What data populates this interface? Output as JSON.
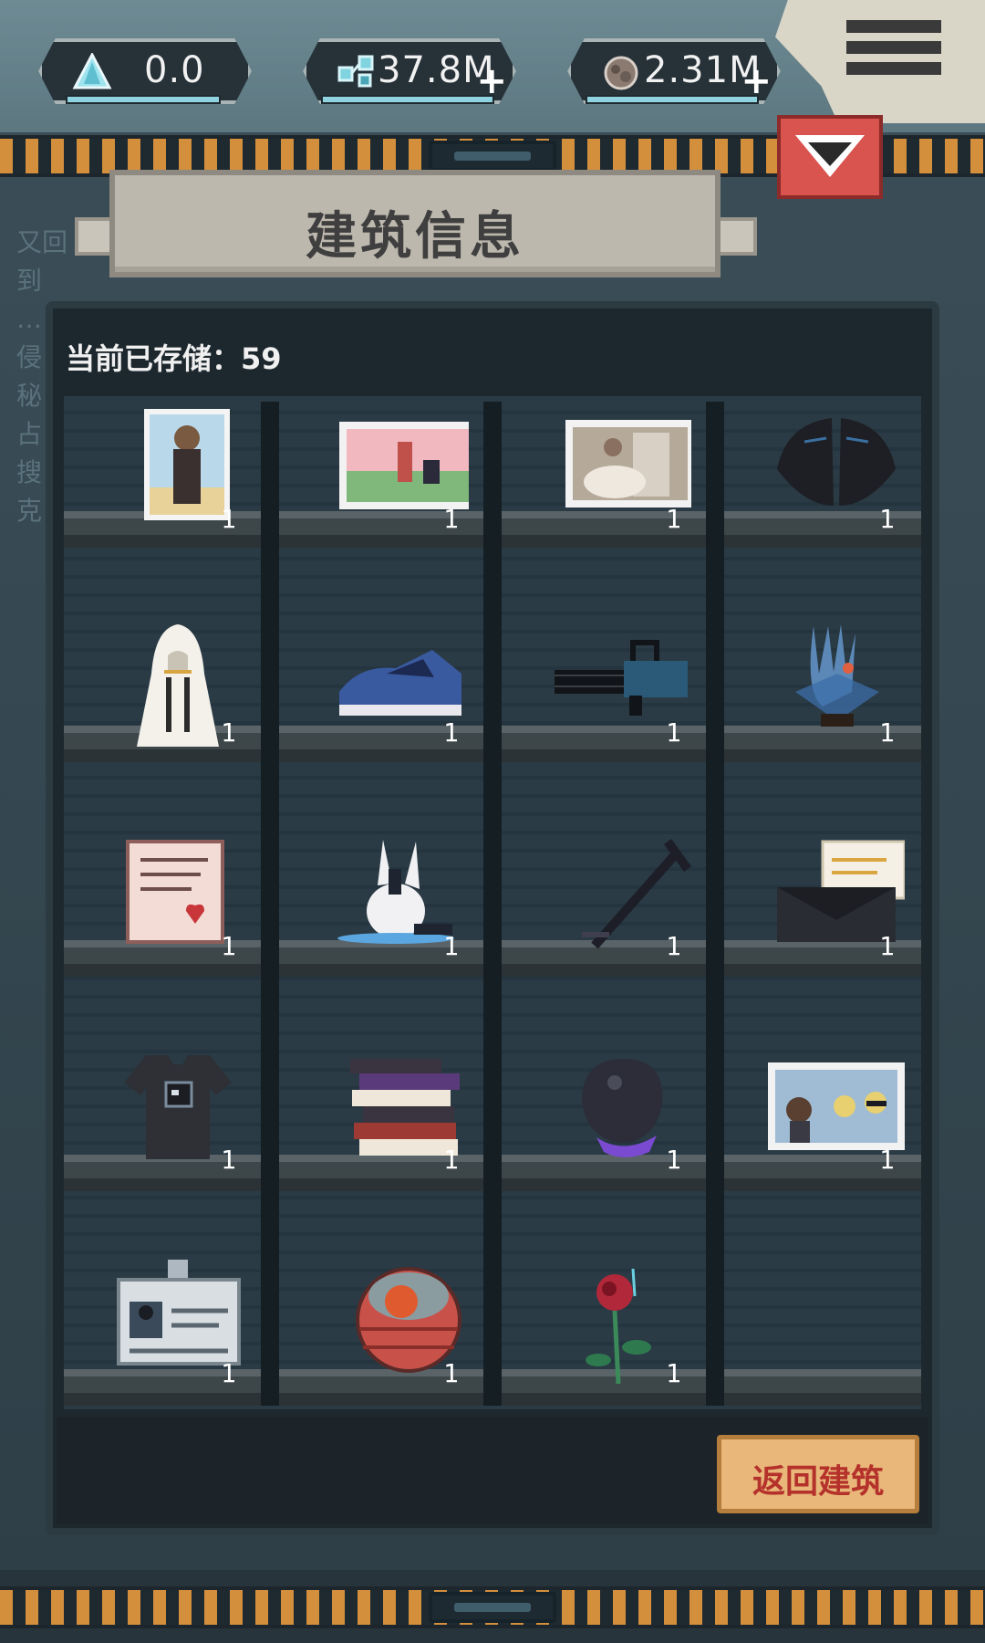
{
  "resources": [
    {
      "icon": "crystal-icon",
      "value": "0.0",
      "has_plus": false
    },
    {
      "icon": "data-chip-icon",
      "value": "37.8M",
      "has_plus": true
    },
    {
      "icon": "ore-icon",
      "value": "2.31M",
      "has_plus": true
    }
  ],
  "ghost_side_text": [
    "又回到",
    "…",
    "侵",
    "秘",
    "占",
    "搜",
    "克"
  ],
  "panel": {
    "title": "建筑信息",
    "stored_label": "当前已存储：59"
  },
  "items": [
    {
      "name": "portrait-photo-icon",
      "count": "1"
    },
    {
      "name": "beach-photo-icon",
      "count": "1"
    },
    {
      "name": "wedding-photo-icon",
      "count": "1"
    },
    {
      "name": "black-wings-icon",
      "count": "1"
    },
    {
      "name": "white-cloak-icon",
      "count": "1"
    },
    {
      "name": "sneaker-icon",
      "count": "1"
    },
    {
      "name": "minigun-icon",
      "count": "1"
    },
    {
      "name": "crystal-hand-icon",
      "count": "1"
    },
    {
      "name": "letter-icon",
      "count": "1"
    },
    {
      "name": "plush-toy-icon",
      "count": "1"
    },
    {
      "name": "cane-icon",
      "count": "1"
    },
    {
      "name": "envelope-icon",
      "count": "1"
    },
    {
      "name": "tshirt-icon",
      "count": "1"
    },
    {
      "name": "book-stack-icon",
      "count": "1"
    },
    {
      "name": "dark-orb-icon",
      "count": "1"
    },
    {
      "name": "group-photo-icon",
      "count": "1"
    },
    {
      "name": "id-badge-icon",
      "count": "1"
    },
    {
      "name": "fruit-basket-icon",
      "count": "1"
    },
    {
      "name": "rose-icon",
      "count": "1"
    }
  ],
  "buttons": {
    "return": "返回建筑"
  }
}
